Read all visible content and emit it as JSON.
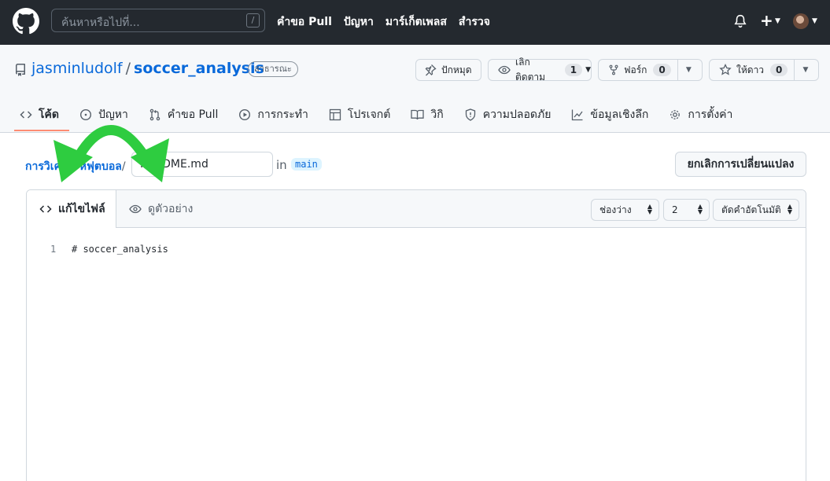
{
  "header": {
    "search_placeholder": "ค้นหาหรือไปที่...",
    "search_shortcut": "/",
    "nav": [
      "คำขอ Pull",
      "ปัญหา",
      "มาร์เก็ตเพลส",
      "สำรวจ"
    ],
    "plus_label": "+"
  },
  "repo": {
    "owner": "jasminludolf",
    "separator": "/",
    "name": "soccer_analysis",
    "visibility": "สาธารณะ",
    "pin_label": "ปักหมุด",
    "watch_label": "เลิกติดตาม",
    "watch_count": "1",
    "fork_label": "ฟอร์ก",
    "fork_count": "0",
    "star_label": "ให้ดาว",
    "star_count": "0"
  },
  "tabs": [
    {
      "label": "โค้ด",
      "icon": "code-icon"
    },
    {
      "label": "ปัญหา",
      "icon": "issue-icon"
    },
    {
      "label": "คำขอ Pull",
      "icon": "pull-request-icon"
    },
    {
      "label": "การกระทำ",
      "icon": "play-icon"
    },
    {
      "label": "โปรเจกต์",
      "icon": "table-icon"
    },
    {
      "label": "วิกิ",
      "icon": "book-icon"
    },
    {
      "label": "ความปลอดภัย",
      "icon": "shield-icon"
    },
    {
      "label": "ข้อมูลเชิงลึก",
      "icon": "graph-icon"
    },
    {
      "label": "การตั้งค่า",
      "icon": "gear-icon"
    }
  ],
  "edit": {
    "breadcrumb": "การวิเคราะห์ฟุตบอล",
    "breadcrumb_sep": "/",
    "filename": "README.md",
    "in_label": "in",
    "branch": "main",
    "cancel_label": "ยกเลิกการเปลี่ยนแปลง"
  },
  "editor": {
    "edit_tab": "แก้ไขไฟล์",
    "preview_tab": "ดูตัวอย่าง",
    "indent_mode": "ช่องว่าง",
    "indent_size": "2",
    "wrap_mode": "ตัดคำอัตโนมัติ",
    "lines": [
      {
        "num": "1",
        "text": "# soccer_analysis"
      }
    ]
  },
  "annotation": {
    "arrow_color": "#2ecc40",
    "arrow_icon": "curved-double-arrow-icon"
  }
}
